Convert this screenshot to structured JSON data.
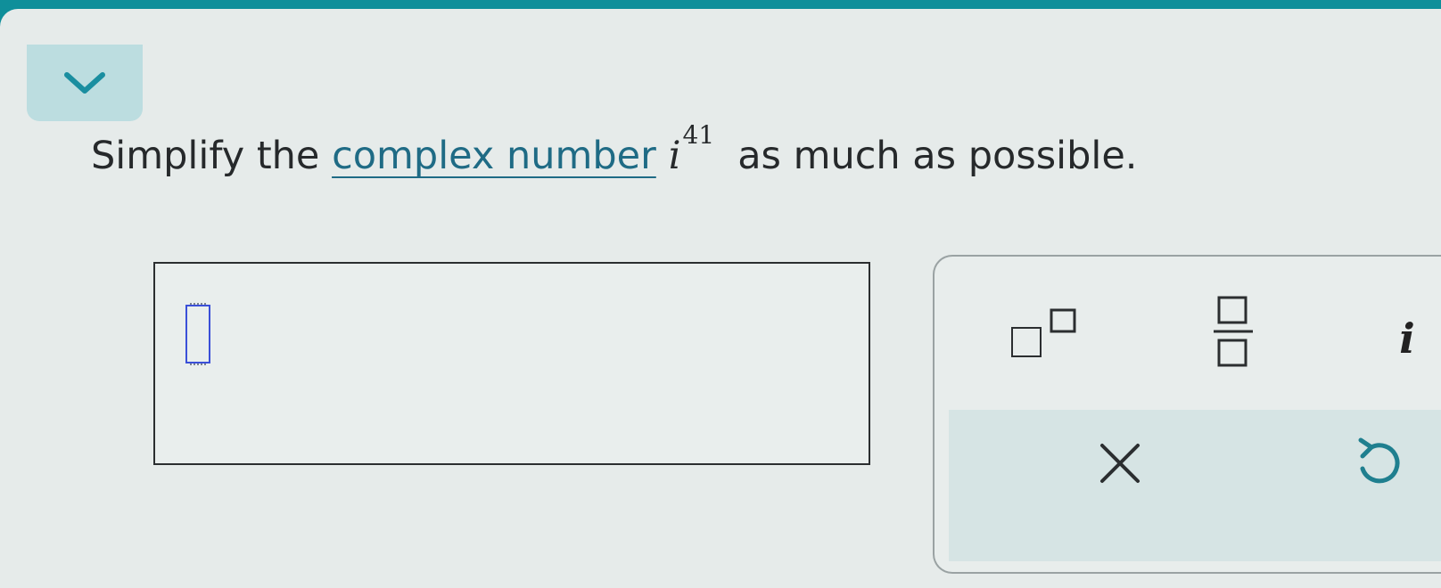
{
  "question": {
    "prefix": "Simplify the ",
    "term_link": "complex number",
    "math_base": "i",
    "math_exponent": "41",
    "suffix": "as much as possible."
  },
  "keypad": {
    "i_key_label": "i"
  },
  "colors": {
    "top_bar": "#0f8f9a",
    "collapse_button": "#bcdde0",
    "chevron": "#1a8ea0",
    "link": "#1f6b85",
    "cursor": "#3a4fd8",
    "undo_icon": "#1f7f8f"
  },
  "icons": {
    "collapse": "chevron-down-icon",
    "exponent": "exponent-template-icon",
    "fraction": "fraction-template-icon",
    "clear": "clear-x-icon",
    "undo": "undo-icon"
  }
}
